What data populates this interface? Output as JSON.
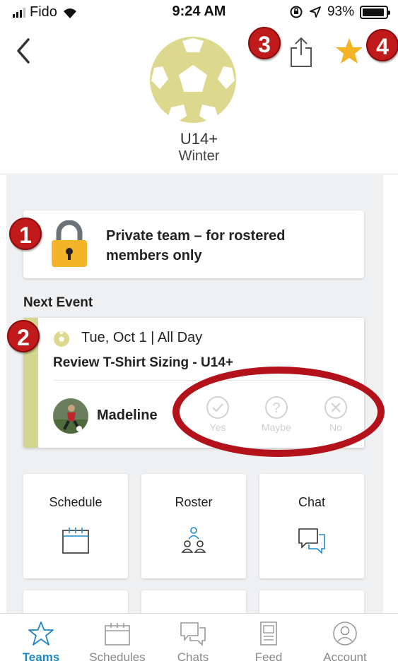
{
  "status_bar": {
    "carrier": "Fido",
    "time": "9:24 AM",
    "battery": "93%",
    "battery_level": 0.93
  },
  "header": {
    "team_name": "U14+",
    "season": "Winter",
    "icons": [
      "back-chevron-icon",
      "soccer-ball-icon",
      "share-icon",
      "star-icon"
    ]
  },
  "annotations": [
    "1",
    "2",
    "3",
    "4"
  ],
  "private_notice": {
    "text": "Private team – for rostered members only",
    "icon": "padlock-icon"
  },
  "next_event": {
    "section_label": "Next Event",
    "date": "Tue, Oct 1 | All Day",
    "title": "Review T-Shirt Sizing - U14+",
    "member_name": "Madeline",
    "rsvp": {
      "yes": "Yes",
      "maybe": "Maybe",
      "no": "No"
    }
  },
  "tiles": [
    {
      "label": "Schedule",
      "icon": "calendar-icon"
    },
    {
      "label": "Roster",
      "icon": "people-icon"
    },
    {
      "label": "Chat",
      "icon": "chat-bubbles-icon"
    }
  ],
  "tab_bar": [
    {
      "label": "Teams",
      "icon": "star-outline-icon",
      "active": true
    },
    {
      "label": "Schedules",
      "icon": "calendar-icon",
      "active": false
    },
    {
      "label": "Chats",
      "icon": "chat-bubbles-icon",
      "active": false
    },
    {
      "label": "Feed",
      "icon": "document-icon",
      "active": false
    },
    {
      "label": "Account",
      "icon": "user-circle-icon",
      "active": false
    }
  ],
  "colors": {
    "accent": "#1e88c9",
    "badge_red": "#c01a1a",
    "event_stripe": "#d4d68f",
    "star_gold": "#f5b324",
    "logo_khaki": "#dcd98f"
  }
}
